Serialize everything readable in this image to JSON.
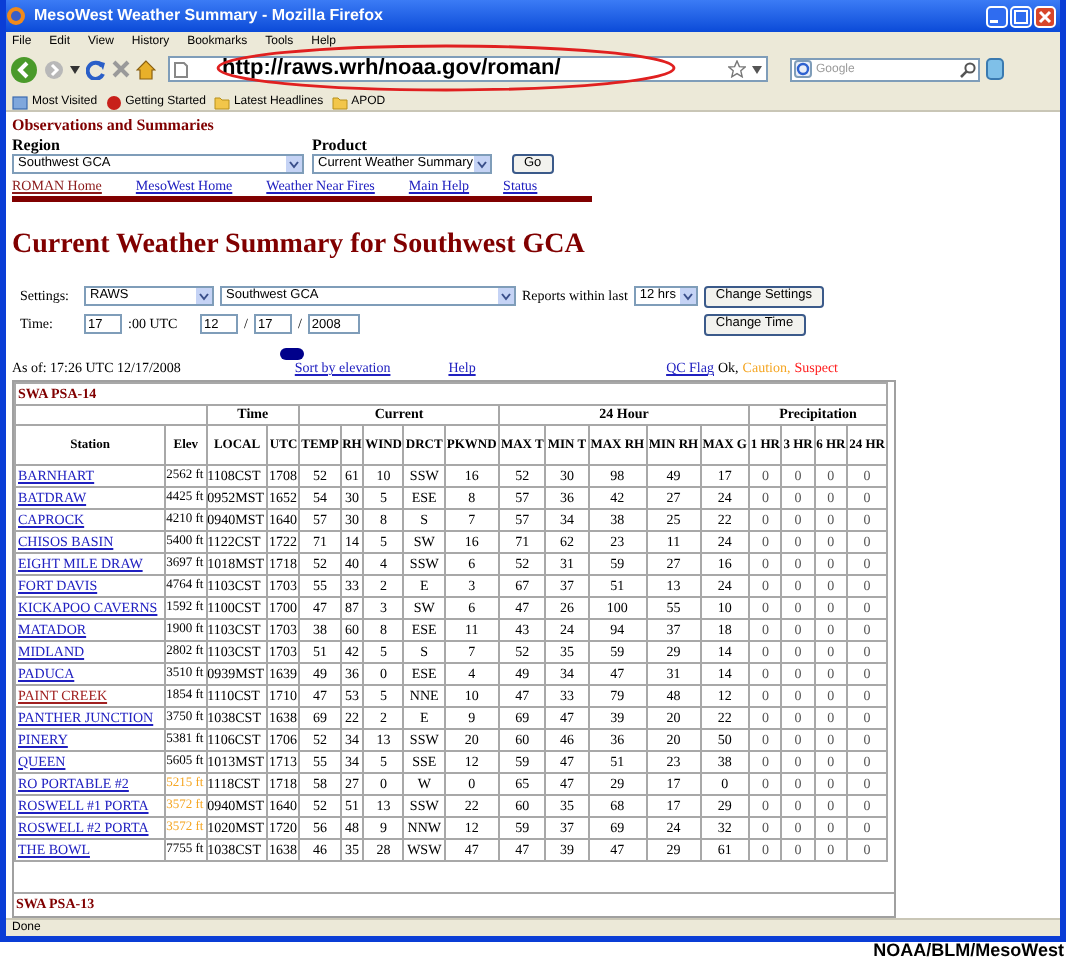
{
  "window": {
    "title": "MesoWest Weather Summary - Mozilla Firefox"
  },
  "menu": [
    "File",
    "Edit",
    "View",
    "History",
    "Bookmarks",
    "Tools",
    "Help"
  ],
  "address_bar": {
    "url": "http://raws.wrh/noaa.gov/roman/"
  },
  "search": {
    "placeholder": "Google"
  },
  "bookmarks": [
    "Most Visited",
    "Getting Started",
    "Latest Headlines",
    "APOD"
  ],
  "page": {
    "section_title": "Observations and Summaries",
    "region": {
      "label": "Region",
      "value": "Southwest GCA"
    },
    "product": {
      "label": "Product",
      "value": "Current Weather Summary"
    },
    "go_button": "Go",
    "nav_links": [
      {
        "label": "ROMAN Home",
        "visited": true
      },
      {
        "label": "MesoWest Home",
        "visited": false
      },
      {
        "label": "Weather Near Fires",
        "visited": false
      },
      {
        "label": "Main Help",
        "visited": false
      },
      {
        "label": "Status",
        "visited": false
      }
    ],
    "heading": "Current Weather Summary for Southwest GCA",
    "settings": {
      "label": "Settings:",
      "network": "RAWS",
      "area": "Southwest GCA",
      "reports_label": "Reports within last",
      "hours": "12 hrs",
      "button": "Change Settings"
    },
    "time": {
      "label": "Time:",
      "hour": "17",
      "utc_label": ":00 UTC",
      "month": "12",
      "day": "17",
      "year": "2008",
      "separator": "/",
      "button": "Change Time"
    },
    "as_of": "As of: 17:26 UTC 12/17/2008",
    "links": [
      "Sort by elevation",
      "Help"
    ],
    "qc": {
      "link": "QC Flag",
      "levels": [
        {
          "label": "Ok,",
          "color": "#000000"
        },
        {
          "label": "Caution,",
          "color": "#f5a623"
        },
        {
          "label": "Suspect",
          "color": "#ff2020"
        }
      ]
    },
    "table": {
      "section": "SWA PSA-14",
      "columns": [
        "Station",
        "Elev"
      ],
      "groups": [
        {
          "label": "Time",
          "columns": [
            "LOCAL",
            "UTC"
          ]
        },
        {
          "label": "Current",
          "columns": [
            "TEMP",
            "RH",
            "WIND",
            "DRCT",
            "PKWND"
          ]
        },
        {
          "label": "24 Hour",
          "columns": [
            "MAX T",
            "MIN T",
            "MAX RH",
            "MIN RH",
            "MAX G"
          ]
        },
        {
          "label": "Precipitation",
          "columns": [
            "1 HR",
            "3 HR",
            "6 HR",
            "24 HR"
          ]
        }
      ],
      "rows": [
        {
          "visited": false,
          "caution": false,
          "cells": [
            "BARNHART",
            "2562 ft",
            "1108CST",
            "1708",
            "52",
            "61",
            "10",
            "SSW",
            "16",
            "52",
            "30",
            "98",
            "49",
            "17",
            "0",
            "0",
            "0",
            "0"
          ]
        },
        {
          "visited": false,
          "caution": false,
          "cells": [
            "BATDRAW",
            "4425 ft",
            "0952MST",
            "1652",
            "54",
            "30",
            "5",
            "ESE",
            "8",
            "57",
            "36",
            "42",
            "27",
            "24",
            "0",
            "0",
            "0",
            "0"
          ]
        },
        {
          "visited": false,
          "caution": false,
          "cells": [
            "CAPROCK",
            "4210 ft",
            "0940MST",
            "1640",
            "57",
            "30",
            "8",
            "S",
            "7",
            "57",
            "34",
            "38",
            "25",
            "22",
            "0",
            "0",
            "0",
            "0"
          ]
        },
        {
          "visited": false,
          "caution": false,
          "cells": [
            "CHISOS BASIN",
            "5400 ft",
            "1122CST",
            "1722",
            "71",
            "14",
            "5",
            "SW",
            "16",
            "71",
            "62",
            "23",
            "11",
            "24",
            "0",
            "0",
            "0",
            "0"
          ]
        },
        {
          "visited": false,
          "caution": false,
          "cells": [
            "EIGHT MILE DRAW",
            "3697 ft",
            "1018MST",
            "1718",
            "52",
            "40",
            "4",
            "SSW",
            "6",
            "52",
            "31",
            "59",
            "27",
            "16",
            "0",
            "0",
            "0",
            "0"
          ]
        },
        {
          "visited": false,
          "caution": false,
          "cells": [
            "FORT DAVIS",
            "4764 ft",
            "1103CST",
            "1703",
            "55",
            "33",
            "2",
            "E",
            "3",
            "67",
            "37",
            "51",
            "13",
            "24",
            "0",
            "0",
            "0",
            "0"
          ]
        },
        {
          "visited": false,
          "caution": false,
          "cells": [
            "KICKAPOO CAVERNS",
            "1592 ft",
            "1100CST",
            "1700",
            "47",
            "87",
            "3",
            "SW",
            "6",
            "47",
            "26",
            "100",
            "55",
            "10",
            "0",
            "0",
            "0",
            "0"
          ]
        },
        {
          "visited": false,
          "caution": false,
          "cells": [
            "MATADOR",
            "1900 ft",
            "1103CST",
            "1703",
            "38",
            "60",
            "8",
            "ESE",
            "11",
            "43",
            "24",
            "94",
            "37",
            "18",
            "0",
            "0",
            "0",
            "0"
          ]
        },
        {
          "visited": false,
          "caution": false,
          "cells": [
            "MIDLAND",
            "2802 ft",
            "1103CST",
            "1703",
            "51",
            "42",
            "5",
            "S",
            "7",
            "52",
            "35",
            "59",
            "29",
            "14",
            "0",
            "0",
            "0",
            "0"
          ]
        },
        {
          "visited": false,
          "caution": false,
          "cells": [
            "PADUCA",
            "3510 ft",
            "0939MST",
            "1639",
            "49",
            "36",
            "0",
            "ESE",
            "4",
            "49",
            "34",
            "47",
            "31",
            "14",
            "0",
            "0",
            "0",
            "0"
          ]
        },
        {
          "visited": true,
          "caution": false,
          "cells": [
            "PAINT CREEK",
            "1854 ft",
            "1110CST",
            "1710",
            "47",
            "53",
            "5",
            "NNE",
            "10",
            "47",
            "33",
            "79",
            "48",
            "12",
            "0",
            "0",
            "0",
            "0"
          ]
        },
        {
          "visited": false,
          "caution": false,
          "cells": [
            "PANTHER JUNCTION",
            "3750 ft",
            "1038CST",
            "1638",
            "69",
            "22",
            "2",
            "E",
            "9",
            "69",
            "47",
            "39",
            "20",
            "22",
            "0",
            "0",
            "0",
            "0"
          ]
        },
        {
          "visited": false,
          "caution": false,
          "cells": [
            "PINERY",
            "5381 ft",
            "1106CST",
            "1706",
            "52",
            "34",
            "13",
            "SSW",
            "20",
            "60",
            "46",
            "36",
            "20",
            "50",
            "0",
            "0",
            "0",
            "0"
          ]
        },
        {
          "visited": false,
          "caution": false,
          "cells": [
            "QUEEN",
            "5605 ft",
            "1013MST",
            "1713",
            "55",
            "34",
            "5",
            "SSE",
            "12",
            "59",
            "47",
            "51",
            "23",
            "38",
            "0",
            "0",
            "0",
            "0"
          ]
        },
        {
          "visited": false,
          "caution": true,
          "cells": [
            "RO PORTABLE #2",
            "5215 ft",
            "1118CST",
            "1718",
            "58",
            "27",
            "0",
            "W",
            "0",
            "65",
            "47",
            "29",
            "17",
            "0",
            "0",
            "0",
            "0",
            "0"
          ]
        },
        {
          "visited": false,
          "caution": true,
          "cells": [
            "ROSWELL #1 PORTA",
            "3572 ft",
            "0940MST",
            "1640",
            "52",
            "51",
            "13",
            "SSW",
            "22",
            "60",
            "35",
            "68",
            "17",
            "29",
            "0",
            "0",
            "0",
            "0"
          ]
        },
        {
          "visited": false,
          "caution": true,
          "cells": [
            "ROSWELL #2 PORTA",
            "3572 ft",
            "1020MST",
            "1720",
            "56",
            "48",
            "9",
            "NNW",
            "12",
            "59",
            "37",
            "69",
            "24",
            "32",
            "0",
            "0",
            "0",
            "0"
          ]
        },
        {
          "visited": false,
          "caution": false,
          "cells": [
            "THE BOWL",
            "7755 ft",
            "1038CST",
            "1638",
            "46",
            "35",
            "28",
            "WSW",
            "47",
            "47",
            "39",
            "47",
            "29",
            "61",
            "0",
            "0",
            "0",
            "0"
          ]
        }
      ],
      "next_section": "SWA PSA-13"
    }
  },
  "status_bar": "Done",
  "caption": "NOAA/BLM/MesoWest"
}
